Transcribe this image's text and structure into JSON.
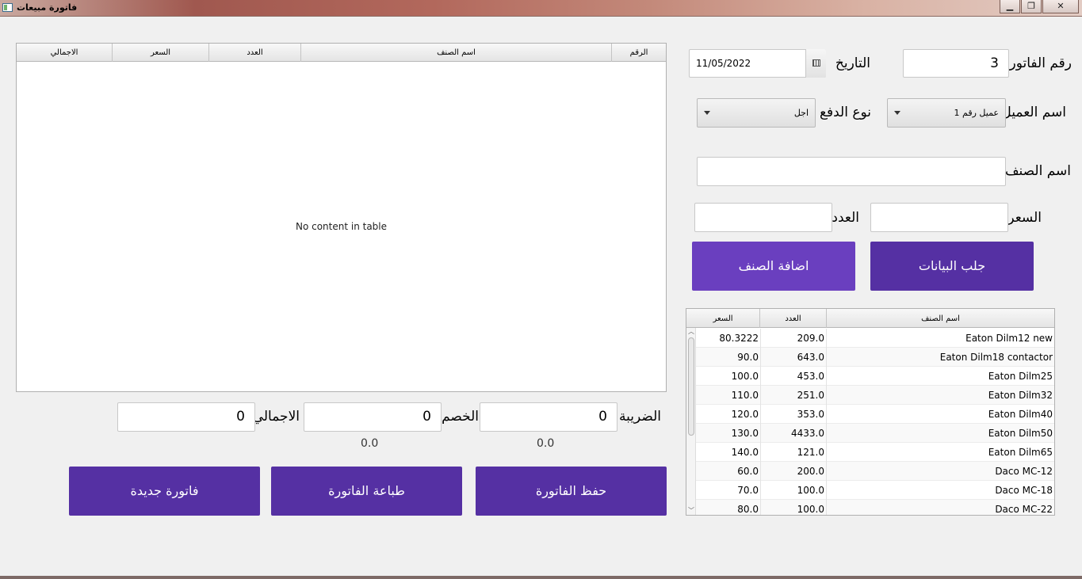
{
  "window": {
    "title": "فاتورة مبيعات",
    "min": "▁",
    "max": "❐",
    "close": "✕"
  },
  "form": {
    "invoice_no_label": "رقم الفاتورة",
    "invoice_no_value": "3",
    "date_label": "التاريخ",
    "date_value": "11/05/2022",
    "customer_label": "اسم العميل",
    "customer_value": "عميل رقم 1",
    "payment_label": "نوع الدفع",
    "payment_value": "اجل",
    "item_name_label": "اسم الصنف",
    "item_name_value": "",
    "price_label": "السعر",
    "price_value": "",
    "count_label": "العدد",
    "count_value": "",
    "fetch_button": "جلب البيانات",
    "add_item_button": "اضافة الصنف"
  },
  "invoice_table": {
    "headers": {
      "total": "الاجمالي",
      "price": "السعر",
      "count": "العدد",
      "name": "اسم الصنف",
      "num": "الرقم"
    },
    "empty_message": "No content in table"
  },
  "totals": {
    "tax_label": "الضريبة",
    "tax_value": "0",
    "tax_calc": "0.0",
    "discount_label": "الخصم",
    "discount_value": "0",
    "discount_calc": "0.0",
    "grand_label": "الاجمالي",
    "grand_value": "0"
  },
  "actions": {
    "save": "حفظ الفاتورة",
    "print": "طباعة الفاتورة",
    "new": "فاتورة جديدة"
  },
  "items_table": {
    "headers": {
      "price": "السعر",
      "count": "العدد",
      "name": "اسم الصنف"
    },
    "rows": [
      {
        "price": "80.3222",
        "count": "209.0",
        "name": "Eaton Dilm12 new"
      },
      {
        "price": "90.0",
        "count": "643.0",
        "name": "Eaton Dilm18 contactor"
      },
      {
        "price": "100.0",
        "count": "453.0",
        "name": "Eaton Dilm25"
      },
      {
        "price": "110.0",
        "count": "251.0",
        "name": "Eaton Dilm32"
      },
      {
        "price": "120.0",
        "count": "353.0",
        "name": "Eaton Dilm40"
      },
      {
        "price": "130.0",
        "count": "4433.0",
        "name": "Eaton Dilm50"
      },
      {
        "price": "140.0",
        "count": "121.0",
        "name": "Eaton Dilm65"
      },
      {
        "price": "60.0",
        "count": "200.0",
        "name": "Daco MC-12"
      },
      {
        "price": "70.0",
        "count": "100.0",
        "name": "Daco MC-18"
      },
      {
        "price": "80.0",
        "count": "100.0",
        "name": "Daco MC-22"
      }
    ]
  }
}
